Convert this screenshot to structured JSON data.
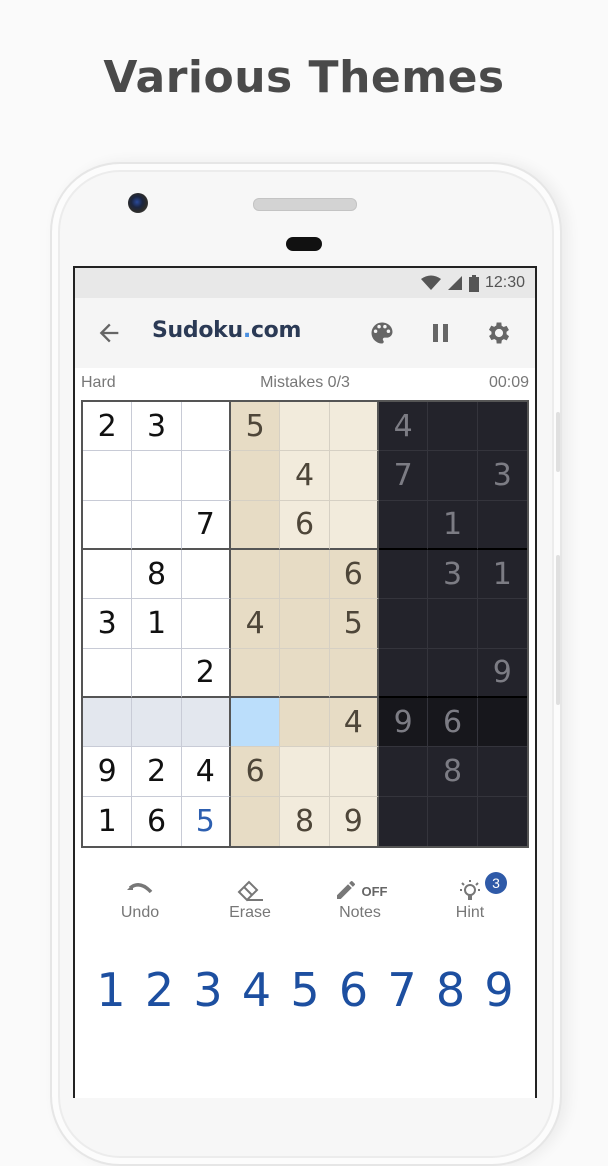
{
  "headline": "Various Themes",
  "statusbar": {
    "time": "12:30",
    "icons": [
      "wifi-icon",
      "cell-signal-icon",
      "battery-icon"
    ]
  },
  "appbar": {
    "logo_main": "Sudoku",
    "logo_dot": ".",
    "logo_tld": "com",
    "icons": [
      "back-arrow-icon",
      "palette-icon",
      "pause-icon",
      "gear-icon"
    ]
  },
  "info": {
    "difficulty": "Hard",
    "mistakes": "Mistakes 0/3",
    "timer": "00:09"
  },
  "board": {
    "themes_by_box_column": [
      "white",
      "beige",
      "dark"
    ],
    "selected_cell": {
      "row": 6,
      "col": 4
    },
    "rows": [
      [
        "2",
        "3",
        "",
        "5",
        "",
        "",
        "4",
        "",
        ""
      ],
      [
        "",
        "",
        "",
        "",
        "4",
        "",
        "7",
        "",
        "3"
      ],
      [
        "",
        "",
        "7",
        "",
        "6",
        "",
        "",
        "1",
        ""
      ],
      [
        "",
        "8",
        "",
        "",
        "",
        "6",
        "",
        "3",
        "1"
      ],
      [
        "3",
        "1",
        "",
        "4",
        "",
        "5",
        "",
        "",
        ""
      ],
      [
        "",
        "",
        "2",
        "",
        "",
        "",
        "",
        "",
        "9"
      ],
      [
        "",
        "",
        "",
        "",
        "",
        "4",
        "9",
        "6",
        ""
      ],
      [
        "9",
        "2",
        "4",
        "6",
        "",
        "",
        "",
        "8",
        ""
      ],
      [
        "1",
        "6",
        "5",
        "",
        "8",
        "9",
        "",
        "",
        ""
      ]
    ],
    "user_entered": [
      [
        8,
        2
      ],
      [
        8,
        8
      ]
    ]
  },
  "tools": [
    {
      "label": "Undo",
      "icon": "undo-icon"
    },
    {
      "label": "Erase",
      "icon": "eraser-icon"
    },
    {
      "label": "Notes",
      "icon": "pencil-icon",
      "state": "OFF"
    },
    {
      "label": "Hint",
      "icon": "lightbulb-icon",
      "badge": "3"
    }
  ],
  "numpad": [
    "1",
    "2",
    "3",
    "4",
    "5",
    "6",
    "7",
    "8",
    "9"
  ],
  "colors": {
    "accent": "#1d4fa0",
    "selected": "#bbdefb",
    "badge": "#2f5aa8"
  }
}
